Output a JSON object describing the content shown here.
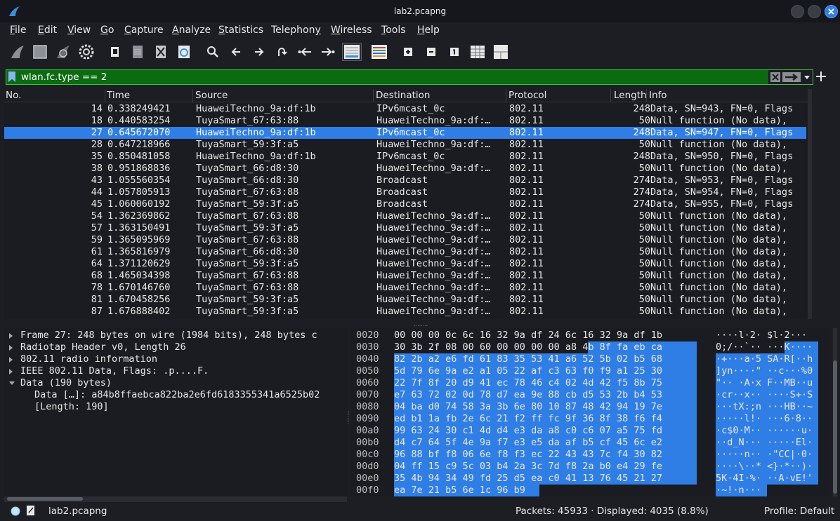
{
  "window": {
    "title": "lab2.pcapng"
  },
  "menu": [
    "File",
    "Edit",
    "View",
    "Go",
    "Capture",
    "Analyze",
    "Statistics",
    "Telephony",
    "Wireless",
    "Tools",
    "Help"
  ],
  "menu_underline": [
    "F",
    "E",
    "V",
    "G",
    "C",
    "A",
    "S",
    "y",
    "W",
    "T",
    "H"
  ],
  "toolbar_icons": [
    "shark-fin-start-icon",
    "stop-capture-icon",
    "restart-capture-icon",
    "capture-options-icon",
    "open-file-icon",
    "save-file-icon",
    "close-file-icon",
    "reload-file-icon",
    "find-packet-icon",
    "go-back-icon",
    "go-forward-icon",
    "go-to-packet-icon",
    "first-packet-icon",
    "last-packet-icon",
    "auto-scroll-icon",
    "colorize-icon",
    "zoom-in-icon",
    "zoom-out-icon",
    "normal-size-icon",
    "resize-columns-icon",
    "layout-icon"
  ],
  "filter": {
    "value": "wlan.fc.type == 2"
  },
  "columns": {
    "no": "No.",
    "time": "Time",
    "source": "Source",
    "destination": "Destination",
    "protocol": "Protocol",
    "length": "Length",
    "info": "Info"
  },
  "packets": [
    {
      "no": "14",
      "time": "0.338249421",
      "src": "HuaweiTechno_9a:df:1b",
      "dst": "IPv6mcast_0c",
      "proto": "802.11",
      "len": "248",
      "info": "Data, SN=943, FN=0, Flags"
    },
    {
      "no": "18",
      "time": "0.440583254",
      "src": "TuyaSmart_67:63:88",
      "dst": "HuaweiTechno_9a:df:…",
      "proto": "802.11",
      "len": "50",
      "info": "Null function (No data),"
    },
    {
      "no": "27",
      "time": "0.645672070",
      "src": "HuaweiTechno_9a:df:1b",
      "dst": "IPv6mcast_0c",
      "proto": "802.11",
      "len": "248",
      "info": "Data, SN=947, FN=0, Flags"
    },
    {
      "no": "28",
      "time": "0.647218966",
      "src": "TuyaSmart_59:3f:a5",
      "dst": "HuaweiTechno_9a:df:…",
      "proto": "802.11",
      "len": "50",
      "info": "Null function (No data),"
    },
    {
      "no": "35",
      "time": "0.850481058",
      "src": "HuaweiTechno_9a:df:1b",
      "dst": "IPv6mcast_0c",
      "proto": "802.11",
      "len": "248",
      "info": "Data, SN=950, FN=0, Flags"
    },
    {
      "no": "38",
      "time": "0.951868836",
      "src": "TuyaSmart_66:d8:30",
      "dst": "HuaweiTechno_9a:df:…",
      "proto": "802.11",
      "len": "50",
      "info": "Null function (No data),"
    },
    {
      "no": "43",
      "time": "1.055560354",
      "src": "TuyaSmart_66:d8:30",
      "dst": "Broadcast",
      "proto": "802.11",
      "len": "274",
      "info": "Data, SN=953, FN=0, Flags"
    },
    {
      "no": "44",
      "time": "1.057805913",
      "src": "TuyaSmart_67:63:88",
      "dst": "Broadcast",
      "proto": "802.11",
      "len": "274",
      "info": "Data, SN=954, FN=0, Flags"
    },
    {
      "no": "45",
      "time": "1.060060192",
      "src": "TuyaSmart_59:3f:a5",
      "dst": "Broadcast",
      "proto": "802.11",
      "len": "274",
      "info": "Data, SN=955, FN=0, Flags"
    },
    {
      "no": "54",
      "time": "1.362369862",
      "src": "TuyaSmart_67:63:88",
      "dst": "HuaweiTechno_9a:df:…",
      "proto": "802.11",
      "len": "50",
      "info": "Null function (No data),"
    },
    {
      "no": "57",
      "time": "1.363150491",
      "src": "TuyaSmart_59:3f:a5",
      "dst": "HuaweiTechno_9a:df:…",
      "proto": "802.11",
      "len": "50",
      "info": "Null function (No data),"
    },
    {
      "no": "59",
      "time": "1.365095969",
      "src": "TuyaSmart_67:63:88",
      "dst": "HuaweiTechno_9a:df:…",
      "proto": "802.11",
      "len": "50",
      "info": "Null function (No data),"
    },
    {
      "no": "61",
      "time": "1.365816979",
      "src": "TuyaSmart_66:d8:30",
      "dst": "HuaweiTechno_9a:df:…",
      "proto": "802.11",
      "len": "50",
      "info": "Null function (No data),"
    },
    {
      "no": "64",
      "time": "1.371120629",
      "src": "TuyaSmart_59:3f:a5",
      "dst": "HuaweiTechno_9a:df:…",
      "proto": "802.11",
      "len": "50",
      "info": "Null function (No data),"
    },
    {
      "no": "68",
      "time": "1.465034398",
      "src": "TuyaSmart_67:63:88",
      "dst": "HuaweiTechno_9a:df:…",
      "proto": "802.11",
      "len": "50",
      "info": "Null function (No data),"
    },
    {
      "no": "78",
      "time": "1.670146760",
      "src": "TuyaSmart_67:63:88",
      "dst": "HuaweiTechno_9a:df:…",
      "proto": "802.11",
      "len": "50",
      "info": "Null function (No data),"
    },
    {
      "no": "81",
      "time": "1.670458256",
      "src": "TuyaSmart_59:3f:a5",
      "dst": "HuaweiTechno_9a:df:…",
      "proto": "802.11",
      "len": "50",
      "info": "Null function (No data),"
    },
    {
      "no": "87",
      "time": "1.676888402",
      "src": "TuyaSmart_59:3f:a5",
      "dst": "HuaweiTechno_9a:df:…",
      "proto": "802.11",
      "len": "50",
      "info": "Null function (No data),"
    }
  ],
  "selected_packet": "27",
  "details": [
    {
      "text": "Frame 27: 248 bytes on wire (1984 bits), 248 bytes c",
      "expand": "collapsed"
    },
    {
      "text": "Radiotap Header v0, Length 26",
      "expand": "collapsed"
    },
    {
      "text": "802.11 radio information",
      "expand": "collapsed"
    },
    {
      "text": "IEEE 802.11 Data, Flags: .p....F.",
      "expand": "collapsed"
    },
    {
      "text": "Data (190 bytes)",
      "expand": "expanded"
    },
    {
      "text": "Data […]: a84b8ffaebca822ba2e6fd6183355341a6525b02",
      "expand": "child"
    },
    {
      "text": "[Length: 190]",
      "expand": "child"
    }
  ],
  "bytes": [
    {
      "off": "0020",
      "hex": "00 00 00 0c 6c 16 32 9a  df 24 6c 16 32 9a df 1b",
      "ascii": "····l·2·  $l·2···",
      "hl": "none"
    },
    {
      "off": "0030",
      "hex": "30 3b 2f 08 00 60 00 00  00 00 a8 4b 8f fa eb ca",
      "ascii": "0;/··`··  ···K····",
      "hl": "partial"
    },
    {
      "off": "0040",
      "hex": "82 2b a2 e6 fd 61 83 35  53 41 a6 52 5b 02 b5 68",
      "ascii": "·+···a·5 SA·R[··h",
      "hl": "full"
    },
    {
      "off": "0050",
      "hex": "5d 79 6e 9a e2 a1 05 22  af c3 63 f0 f9 a1 25 30",
      "ascii": "]yn····\" ··c···%0",
      "hl": "full"
    },
    {
      "off": "0060",
      "hex": "22 7f 8f 20 d9 41 ec 78  46 c4 02 4d 42 f5 8b 75",
      "ascii": "\"·· ·A·x F··MB··u",
      "hl": "full"
    },
    {
      "off": "0070",
      "hex": "e7 63 72 02 0d 78 d7 ea  9e 88 cb d5 53 2b b4 53",
      "ascii": "·cr··x·· ····S+·S",
      "hl": "full"
    },
    {
      "off": "0080",
      "hex": "04 ba d0 74 58 3a 3b 6e  80 10 87 48 42 94 19 7e",
      "ascii": "···tX:;n ···HB··~",
      "hl": "full"
    },
    {
      "off": "0090",
      "hex": "ed b1 1a fb 2e 6c 21 f2  ff fc 9f 36 8f 38 f6 f4",
      "ascii": "·····l!· ···6·8··",
      "hl": "full"
    },
    {
      "off": "00a0",
      "hex": "99 63 24 30 c1 4d d4 e3  da a8 c0 c6 07 a5 75 fd",
      "ascii": "·c$0·M·· ······u·",
      "hl": "full"
    },
    {
      "off": "00b0",
      "hex": "d4 c7 64 5f 4e 9a f7 e3  e5 da af b5 cf 45 6c e2",
      "ascii": "··d_N··· ·····El·",
      "hl": "full"
    },
    {
      "off": "00c0",
      "hex": "96 88 bf f8 06 6e f8 f3  ec 22 43 43 7c f4 30 82",
      "ascii": "·····n·· ·\"CC|·0·",
      "hl": "full"
    },
    {
      "off": "00d0",
      "hex": "04 ff 15 c9 5c 03 b4 2a  3c 7d f8 2a b0 e4 29 fe",
      "ascii": "····\\··* <}·*··)·",
      "hl": "full"
    },
    {
      "off": "00e0",
      "hex": "35 4b 94 34 49 fd 25 d5  ea c0 41 13 76 45 21 27",
      "ascii": "5K·4I·%· ··A·vE!'",
      "hl": "full"
    },
    {
      "off": "00f0",
      "hex": "ea 7e 21 b5 6e 1c 96 b9",
      "ascii": "·~!·n···",
      "hl": "last"
    }
  ],
  "status": {
    "file": "lab2.pcapng",
    "packets": "Packets: 45933 · Displayed: 4035 (8.8%)",
    "profile": "Profile: Default"
  },
  "colors": {
    "selection": "#2f7ee6",
    "filter_valid": "#0b6b10",
    "background": "#1a1c21"
  }
}
